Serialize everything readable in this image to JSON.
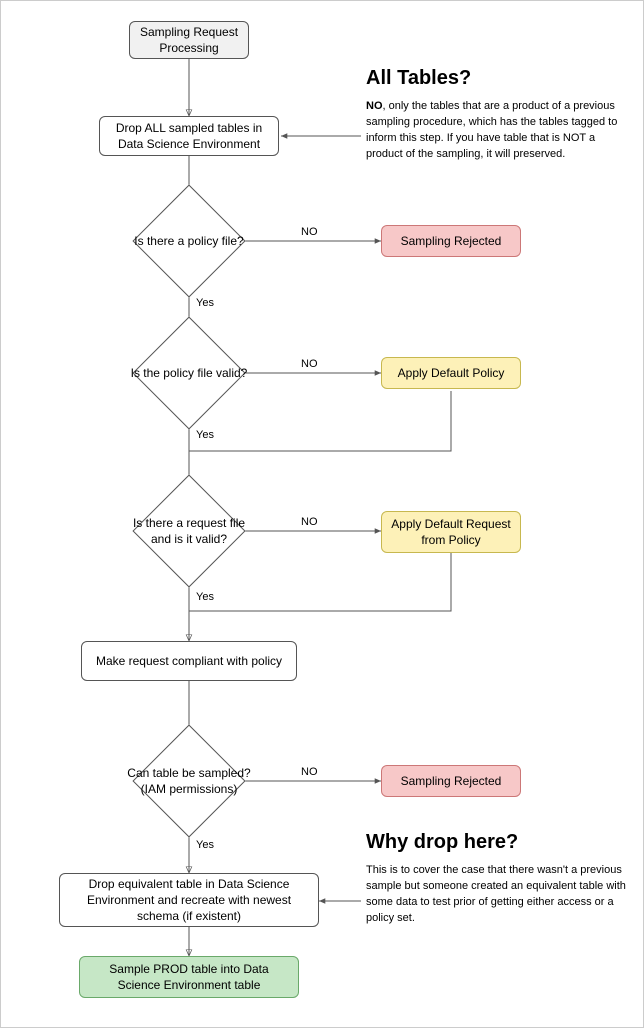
{
  "nodes": {
    "start": "Sampling Request\nProcessing",
    "drop_all": "Drop ALL sampled tables in\nData Science Environment",
    "policy_q": "Is there a policy file?",
    "valid_q": "Is the policy file valid?",
    "request_q": "Is there a request file\nand is it valid?",
    "compliant": "Make request compliant with policy",
    "iam_q": "Can table be sampled?\n(IAM permissions)",
    "drop_equiv": "Drop equivalent table in\nData Science Environment\nand recreate with newest schema (if existent)",
    "sample": "Sample PROD table into\nData Science Environment table",
    "rejected1": "Sampling Rejected",
    "default_policy": "Apply Default Policy",
    "default_request": "Apply Default\nRequest from Policy",
    "rejected2": "Sampling Rejected"
  },
  "edge_labels": {
    "no": "NO",
    "yes": "Yes"
  },
  "annotations": {
    "all_tables_title": "All Tables?",
    "all_tables_body_bold": "NO",
    "all_tables_body_rest": ", only the tables that are a product of a previous sampling procedure, which has the tables tagged to inform this step. If you have table that is NOT a product of the sampling, it will preserved.",
    "why_drop_title": "Why drop here?",
    "why_drop_body": "This is to cover the case that there wasn't a previous sample but someone created an equivalent table with some data to test prior of getting either access or a policy set."
  }
}
